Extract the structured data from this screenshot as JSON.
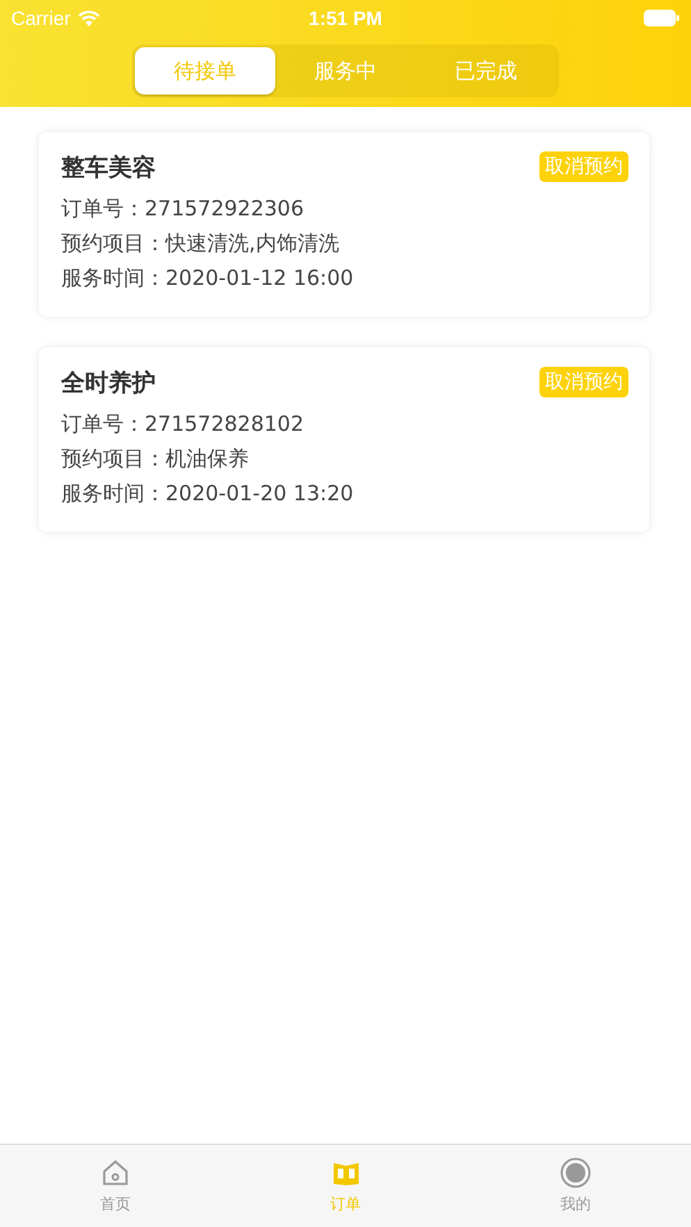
{
  "status_bar": {
    "carrier": "Carrier",
    "time": "1:51 PM"
  },
  "segments": [
    {
      "label": "待接单",
      "selected": true
    },
    {
      "label": "服务中",
      "selected": false
    },
    {
      "label": "已完成",
      "selected": false
    }
  ],
  "orders": [
    {
      "title": "整车美容",
      "action": "取消预约",
      "lines": [
        "订单号：271572922306",
        "预约项目：快速清洗,内饰清洗",
        "服务时间：2020-01-12 16:00"
      ]
    },
    {
      "title": "全时养护",
      "action": "取消预约",
      "lines": [
        "订单号：271572828102",
        "预约项目：机油保养",
        "服务时间：2020-01-20 13:20"
      ]
    }
  ],
  "tab_bar": [
    {
      "label": "首页",
      "kind": "home",
      "selected": false
    },
    {
      "label": "订单",
      "kind": "book",
      "selected": true
    },
    {
      "label": "我的",
      "kind": "profile",
      "selected": false
    }
  ]
}
